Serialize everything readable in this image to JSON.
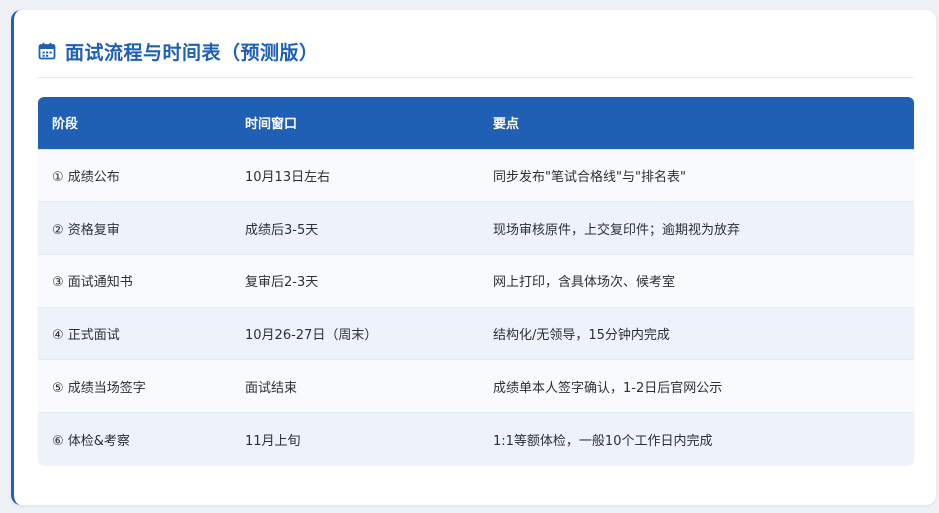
{
  "header": {
    "icon": "calendar-icon",
    "title": "面试流程与时间表（预测版）",
    "accent_color": "#1f5fb4"
  },
  "table": {
    "columns": [
      "阶段",
      "时间窗口",
      "要点"
    ],
    "rows": [
      {
        "stage": "① 成绩公布",
        "window": "10月13日左右",
        "points": "同步发布\"笔试合格线\"与\"排名表\""
      },
      {
        "stage": "② 资格复审",
        "window": "成绩后3-5天",
        "points": "现场审核原件，上交复印件；逾期视为放弃"
      },
      {
        "stage": "③ 面试通知书",
        "window": "复审后2-3天",
        "points": "网上打印，含具体场次、候考室"
      },
      {
        "stage": "④ 正式面试",
        "window": "10月26-27日（周末）",
        "points": "结构化/无领导，15分钟内完成"
      },
      {
        "stage": "⑤ 成绩当场签字",
        "window": "面试结束",
        "points": "成绩单本人签字确认，1-2日后官网公示"
      },
      {
        "stage": "⑥ 体检&考察",
        "window": "11月上旬",
        "points": "1:1等额体检，一般10个工作日内完成"
      }
    ]
  }
}
